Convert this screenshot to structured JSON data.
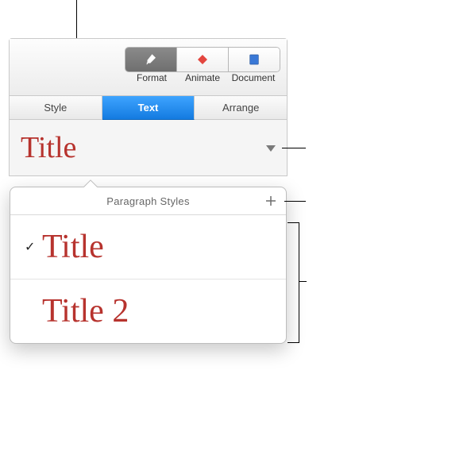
{
  "toolbar": {
    "format_label": "Format",
    "animate_label": "Animate",
    "document_label": "Document"
  },
  "tabs": {
    "style": "Style",
    "text": "Text",
    "arrange": "Arrange"
  },
  "current_style": {
    "name": "Title"
  },
  "popover": {
    "title": "Paragraph Styles",
    "items": [
      {
        "label": "Title",
        "selected": true
      },
      {
        "label": "Title 2",
        "selected": false
      }
    ]
  }
}
